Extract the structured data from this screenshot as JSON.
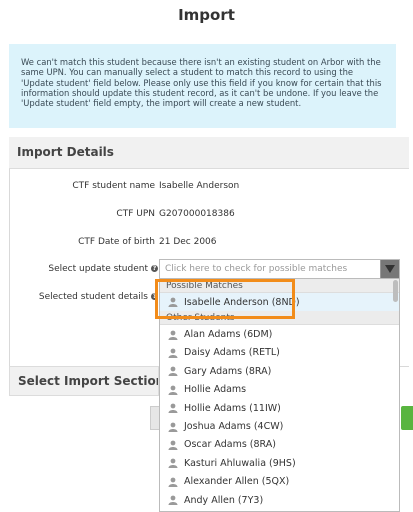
{
  "page": {
    "title": "Import",
    "info": "We can't match this student because there isn't an existing student on Arbor with the same UPN. You can manually select a student to match this record to using the 'Update student' field below. Please only use this field if you know for certain that this information should update this student record, as it can't be undone. If you leave the 'Update student' field empty, the import will create a new student."
  },
  "import_details": {
    "heading": "Import Details",
    "rows": [
      {
        "label": "CTF student name",
        "value": "Isabelle Anderson"
      },
      {
        "label": "CTF UPN",
        "value": "G207000018386"
      },
      {
        "label": "CTF Date of birth",
        "value": "21 Dec 2006"
      }
    ],
    "select_label": "Select update student",
    "selected_label": "Selected student details",
    "select_placeholder": "Click here to check for possible matches"
  },
  "select_import_sections": {
    "heading": "Select Import Sections"
  },
  "dropdown": {
    "possible_matches_label": "Possible Matches",
    "possible_matches": [
      "Isabelle Anderson (8ND)"
    ],
    "other_students_label": "Other Students",
    "other_students": [
      "Alan Adams (6DM)",
      "Daisy Adams (RETL)",
      "Gary Adams (8RA)",
      "Hollie Adams",
      "Hollie Adams (11IW)",
      "Joshua Adams (4CW)",
      "Oscar Adams (8RA)",
      "Kasturi Ahluwalia (9HS)",
      "Alexander Allen (5QX)",
      "Andy Allen (7Y3)"
    ]
  },
  "colors": {
    "info_bg": "#dcf3fb",
    "highlight_border": "#f28c1a",
    "primary_button": "#59b540"
  }
}
